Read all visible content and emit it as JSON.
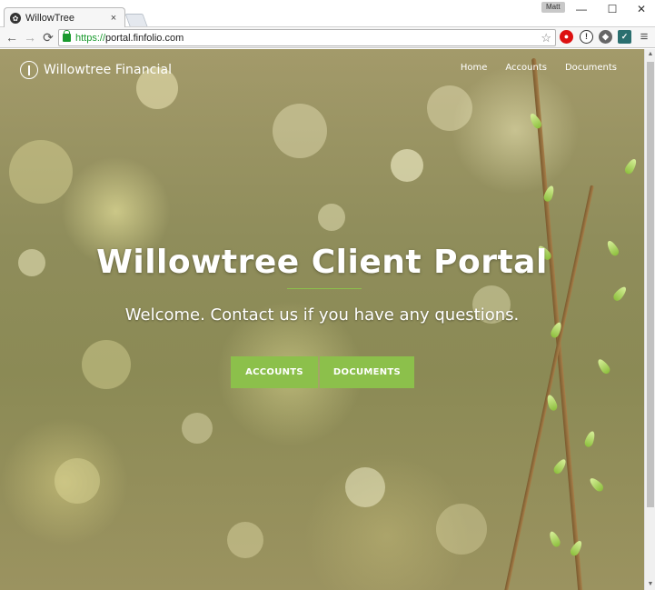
{
  "browser": {
    "tab_title": "WillowTree",
    "tab_close": "×",
    "profile_name": "Matt",
    "window_controls": {
      "minimize": "—",
      "maximize": "☐",
      "close": "✕"
    },
    "nav": {
      "back": "←",
      "forward": "→",
      "reload": "⟳"
    },
    "url_scheme": "https://",
    "url_host": "portal.finfolio.com",
    "bookmark_star": "☆",
    "menu": "≡"
  },
  "site": {
    "brand_name": "Willowtree Financial",
    "nav": [
      {
        "label": "Home"
      },
      {
        "label": "Accounts"
      },
      {
        "label": "Documents"
      }
    ],
    "hero": {
      "title": "Willowtree Client Portal",
      "subtitle": "Welcome. Contact us if you have any questions."
    },
    "buttons": {
      "accounts": "ACCOUNTS",
      "documents": "DOCUMENTS"
    }
  },
  "colors": {
    "accent": "#8cc04b",
    "secure": "#1a9a2e"
  }
}
